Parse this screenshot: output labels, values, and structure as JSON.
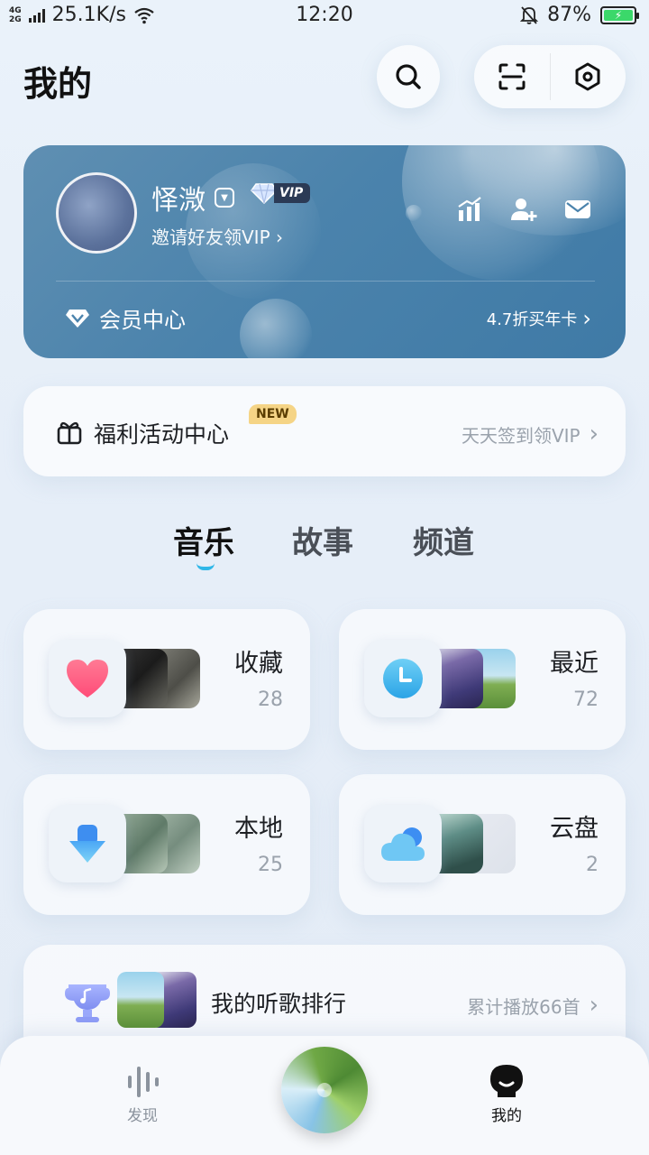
{
  "status_bar": {
    "network_tag_top": "4G",
    "network_tag_bottom": "2G",
    "speed": "25.1K/s",
    "time": "12:20",
    "battery": "87%",
    "battery_color": "#3bd86a"
  },
  "header": {
    "title": "我的",
    "icons": [
      "search-icon",
      "scan-icon",
      "settings-hexagon-icon"
    ]
  },
  "profile": {
    "username": "怿溦",
    "vip_label": "VIP",
    "invite_text": "邀请好友领VIP ›",
    "member_center": "会员中心",
    "discount_text": "4.7折买年卡",
    "icons": [
      "stats-icon",
      "add-friend-icon",
      "mail-icon"
    ]
  },
  "welfare": {
    "title": "福利活动中心",
    "badge": "NEW",
    "right_text": "天天签到领VIP"
  },
  "tabs": [
    {
      "label": "音乐",
      "active": true
    },
    {
      "label": "故事",
      "active": false
    },
    {
      "label": "频道",
      "active": false
    }
  ],
  "library": [
    {
      "name": "收藏",
      "count": "28",
      "icon": "heart-icon"
    },
    {
      "name": "最近",
      "count": "72",
      "icon": "clock-icon"
    },
    {
      "name": "本地",
      "count": "25",
      "icon": "download-icon"
    },
    {
      "name": "云盘",
      "count": "2",
      "icon": "cloud-icon"
    }
  ],
  "ranking": {
    "title": "我的听歌排行",
    "right_text": "累计播放66首"
  },
  "bottom_nav": {
    "discover": "发现",
    "mine": "我的"
  },
  "colors": {
    "accent": "#2fb7e8",
    "card_blue": "#4b83ac",
    "badge_new": "#f5d486"
  }
}
